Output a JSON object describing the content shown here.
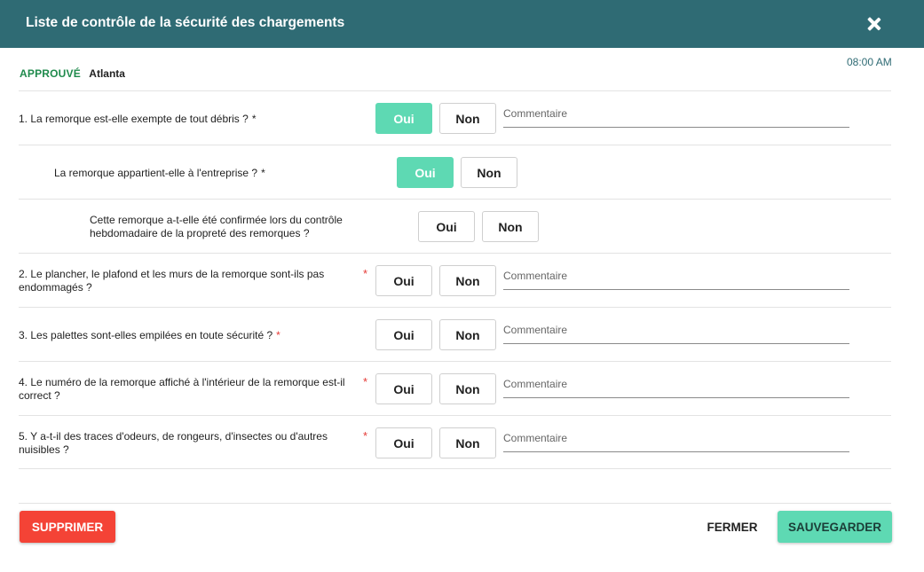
{
  "header": {
    "title": "Liste de contrôle de la sécurité des chargements"
  },
  "status": {
    "label": "APPROUVÉ",
    "location": "Atlanta",
    "time": "08:00 AM"
  },
  "colors": {
    "header_bg": "#2f6b74",
    "approved": "#1f8a4c",
    "selected_button": "#5ed9b3",
    "delete": "#f44336",
    "required_star": "#e53935"
  },
  "options": {
    "yes": "Oui",
    "no": "Non"
  },
  "comment_placeholder": "Commentaire",
  "questions": [
    {
      "text": "1. La remorque est-elle exempte de tout débris ?",
      "required_mark": "*",
      "selected": "Oui"
    },
    {
      "text": "La remorque appartient-elle à l'entreprise ?",
      "required_mark": "*",
      "selected": "Oui"
    },
    {
      "text": "Cette remorque a-t-elle été confirmée lors du contrôle hebdomadaire de la propreté des remorques ?",
      "selected": ""
    },
    {
      "text": "2. Le plancher, le plafond et les murs de la remorque sont-ils pas endommagés ?",
      "required_mark": "*",
      "selected": ""
    },
    {
      "text": "3. Les palettes sont-elles empilées en toute sécurité ?",
      "required_mark": "*",
      "selected": ""
    },
    {
      "text": "4. Le numéro de la remorque affiché à l'intérieur de la remorque est-il correct ?",
      "required_mark": "*",
      "selected": ""
    },
    {
      "text": "5. Y a-t-il des traces d'odeurs, de rongeurs, d'insectes ou d'autres nuisibles ?",
      "required_mark": "*",
      "selected": ""
    }
  ],
  "footer": {
    "delete_label": "SUPPRIMER",
    "close_label": "FERMER",
    "save_label": "SAUVEGARDER"
  }
}
